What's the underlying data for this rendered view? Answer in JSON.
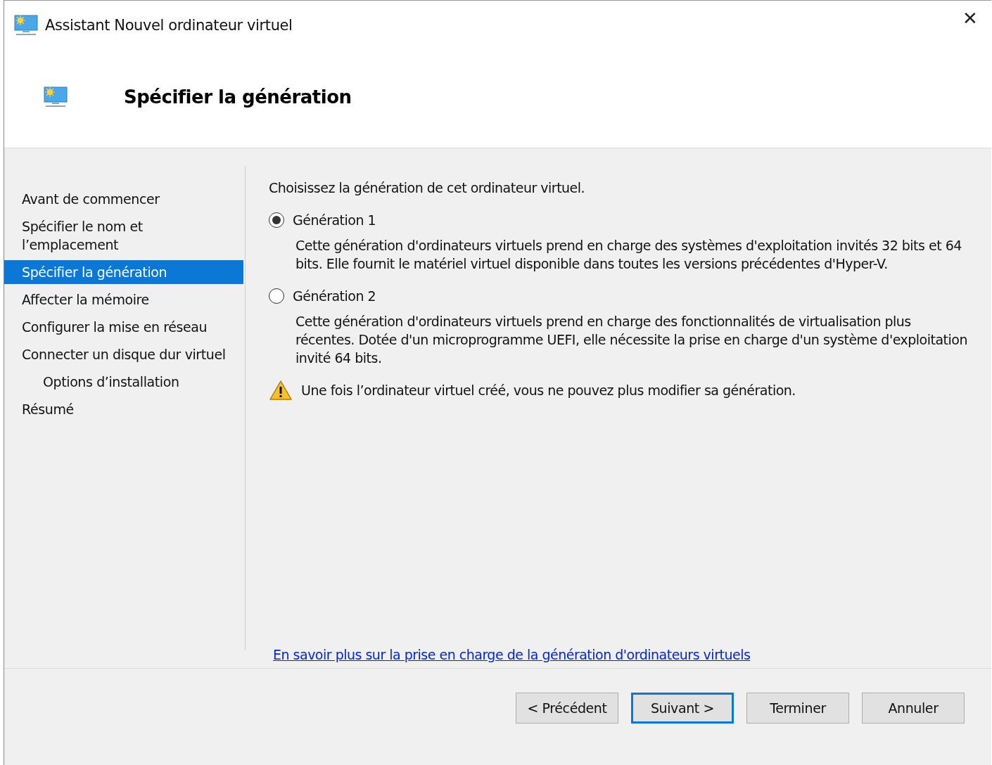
{
  "window": {
    "title": "Assistant Nouvel ordinateur virtuel",
    "close": "✕"
  },
  "header": {
    "title": "Spécifier la génération"
  },
  "sidebar": {
    "items": [
      {
        "label": "Avant de commencer",
        "selected": false
      },
      {
        "label": "Spécifier le nom et l’emplacement",
        "selected": false
      },
      {
        "label": "Spécifier la génération",
        "selected": true
      },
      {
        "label": "Affecter la mémoire",
        "selected": false
      },
      {
        "label": "Configurer la mise en réseau",
        "selected": false
      },
      {
        "label": "Connecter un disque dur virtuel",
        "selected": false,
        "children": [
          {
            "label": "Options d’installation",
            "selected": false
          }
        ]
      },
      {
        "label": "Résumé",
        "selected": false
      }
    ]
  },
  "content": {
    "intro": "Choisissez la génération de cet ordinateur virtuel.",
    "options": [
      {
        "label": "Génération 1",
        "selected": true,
        "description": "Cette génération d'ordinateurs virtuels prend en charge des systèmes d'exploitation invités 32 bits et 64 bits. Elle fournit le matériel virtuel disponible dans toutes les versions précédentes d'Hyper-V."
      },
      {
        "label": "Génération 2",
        "selected": false,
        "description": "Cette génération d'ordinateurs virtuels prend en charge des fonctionnalités de virtualisation plus récentes. Dotée d'un microprogramme UEFI, elle nécessite la prise en charge d'un système d'exploitation invité 64 bits."
      }
    ],
    "warning": "Une fois l’ordinateur virtuel créé, vous ne pouvez plus modifier sa génération.",
    "link": "En savoir plus sur la prise en charge de la génération d'ordinateurs virtuels"
  },
  "buttons": [
    {
      "label": "< Précédent",
      "default": false
    },
    {
      "label": "Suivant >",
      "default": true
    },
    {
      "label": "Terminer",
      "default": false
    },
    {
      "label": "Annuler",
      "default": false
    }
  ]
}
